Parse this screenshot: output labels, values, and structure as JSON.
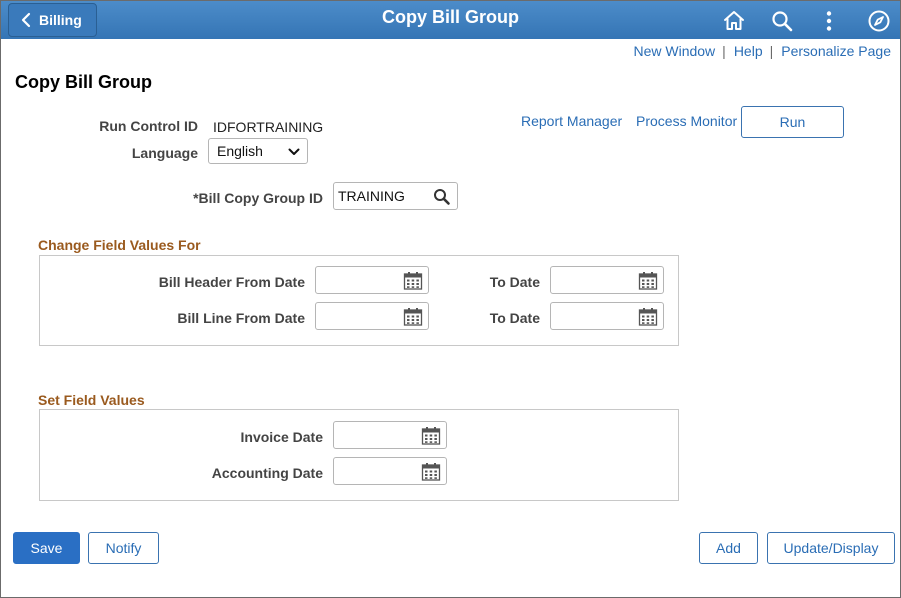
{
  "header": {
    "back_label": "Billing",
    "title": "Copy Bill Group",
    "icons": [
      "home-icon",
      "search-icon",
      "more-icon",
      "compass-icon"
    ]
  },
  "toplinks": {
    "new_window": "New Window",
    "help": "Help",
    "personalize": "Personalize Page",
    "separator": "|"
  },
  "page": {
    "title": "Copy Bill Group",
    "run_control_label": "Run Control ID",
    "run_control_value": "IDFORTRAINING",
    "language_label": "Language",
    "language_value": "English",
    "report_manager": "Report Manager",
    "process_monitor": "Process Monitor",
    "run_label": "Run",
    "bill_copy_group_label": "*Bill Copy Group ID",
    "bill_copy_group_value": "TRAINING"
  },
  "change_section": {
    "title": "Change Field Values For",
    "bill_header_from": "Bill Header From Date",
    "bill_header_to": "To Date",
    "bill_line_from": "Bill Line From Date",
    "bill_line_to": "To Date"
  },
  "set_section": {
    "title": "Set Field Values",
    "invoice_date": "Invoice Date",
    "accounting_date": "Accounting Date"
  },
  "footer": {
    "save": "Save",
    "notify": "Notify",
    "add": "Add",
    "update_display": "Update/Display"
  },
  "colors": {
    "header_bg": "#3f7fbf",
    "link": "#2a6db5",
    "section_title": "#9a5a1e",
    "primary_button": "#2a6fc4"
  }
}
